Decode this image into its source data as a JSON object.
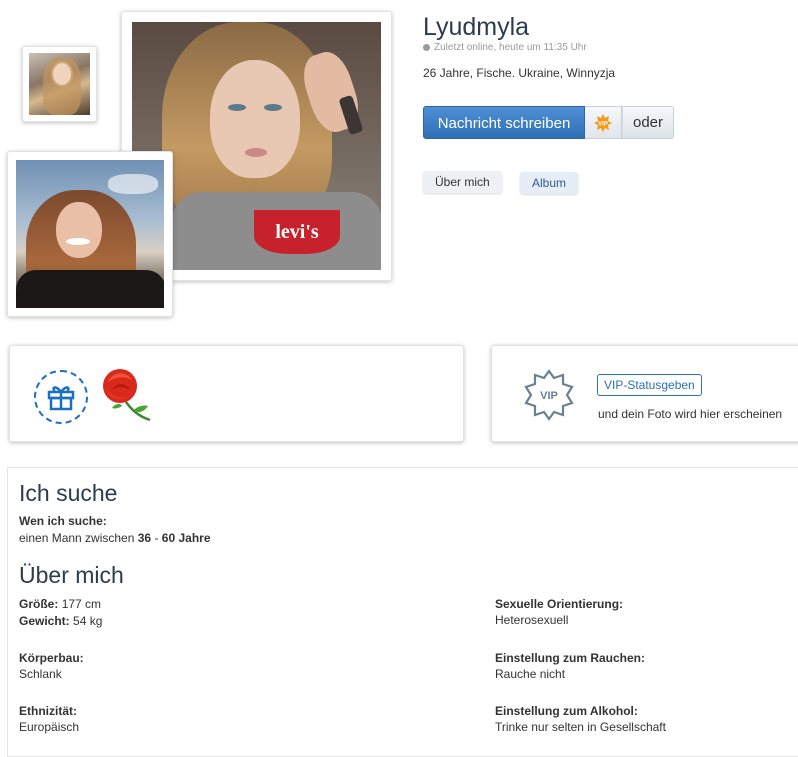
{
  "profile": {
    "name": "Lyudmyla",
    "status": "Zuletzt online, heute um 11:35 Uhr",
    "meta": "26 Jahre, Fische. Ukraine, Winnyzja"
  },
  "actions": {
    "message_label": "Nachricht schreiben",
    "vip_icon_text": "VIP",
    "or_label": "oder"
  },
  "tabs": [
    {
      "label": "Über mich"
    },
    {
      "label": "Album"
    }
  ],
  "vip_promo": {
    "badge_text": "VIP",
    "link_label": "VIP-Statusgeben",
    "text": "und dein Foto wird hier erscheinen"
  },
  "seeking": {
    "title": "Ich suche",
    "label": "Wen ich suche:",
    "text_prefix": "einen Mann zwischen",
    "age_from": "36",
    "separator": "-",
    "age_to": "60 Jahre"
  },
  "about": {
    "title": "Über mich",
    "height_label": "Größe:",
    "height_value": "177 cm",
    "weight_label": "Gewicht:",
    "weight_value": "54 kg",
    "build_label": "Körperbau:",
    "build_value": "Schlank",
    "ethnicity_label": "Ethnizität:",
    "ethnicity_value": "Europäisch",
    "orientation_label": "Sexuelle Orientierung:",
    "orientation_value": "Heterosexuell",
    "smoking_label": "Einstellung zum Rauchen:",
    "smoking_value": "Rauche nicht",
    "alcohol_label": "Einstellung zum Alkohol:",
    "alcohol_value": "Trinke nur selten in Gesellschaft"
  },
  "photo_main_logo": "levi's",
  "colors": {
    "primary": "#2f6fb6",
    "heading": "#2c3b50",
    "gift_outline": "#1d6fc2"
  }
}
